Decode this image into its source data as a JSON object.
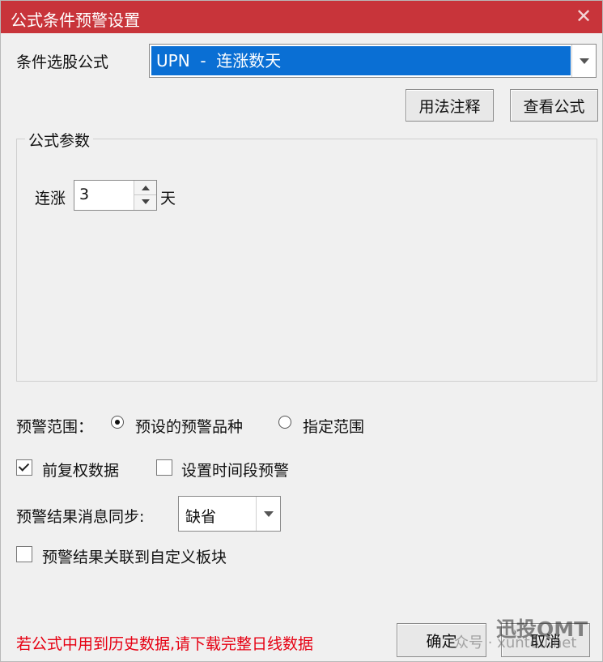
{
  "dialog": {
    "title": "公式条件预警设置",
    "close_glyph": "✕"
  },
  "formula": {
    "label": "条件选股公式",
    "selected": "UPN  -  连涨数天",
    "usage_button": "用法注释",
    "view_button": "查看公式"
  },
  "params": {
    "group_title": "公式参数",
    "prefix": "连涨",
    "value": "3",
    "suffix": "天"
  },
  "scope": {
    "label": "预警范围：",
    "options": [
      {
        "label": "预设的预警品种",
        "selected": true
      },
      {
        "label": "指定范围",
        "selected": false
      }
    ]
  },
  "options": {
    "forward_adjust": {
      "label": "前复权数据",
      "checked": true
    },
    "time_period": {
      "label": "设置时间段预警",
      "checked": false
    },
    "link_block": {
      "label": "预警结果关联到自定义板块",
      "checked": false
    }
  },
  "sync": {
    "label": "预警结果消息同步:",
    "value": "缺省"
  },
  "footer": {
    "warning": "若公式中用到历史数据,请下载完整日线数据",
    "ok_button": "确定",
    "cancel_button": "取消"
  },
  "watermark": {
    "brand": "迅投QMT",
    "sub": "众号 · xuntou.net"
  },
  "colors": {
    "titlebar": "#c8343a",
    "selection": "#0a6fd4",
    "warning_text": "#e60012"
  }
}
